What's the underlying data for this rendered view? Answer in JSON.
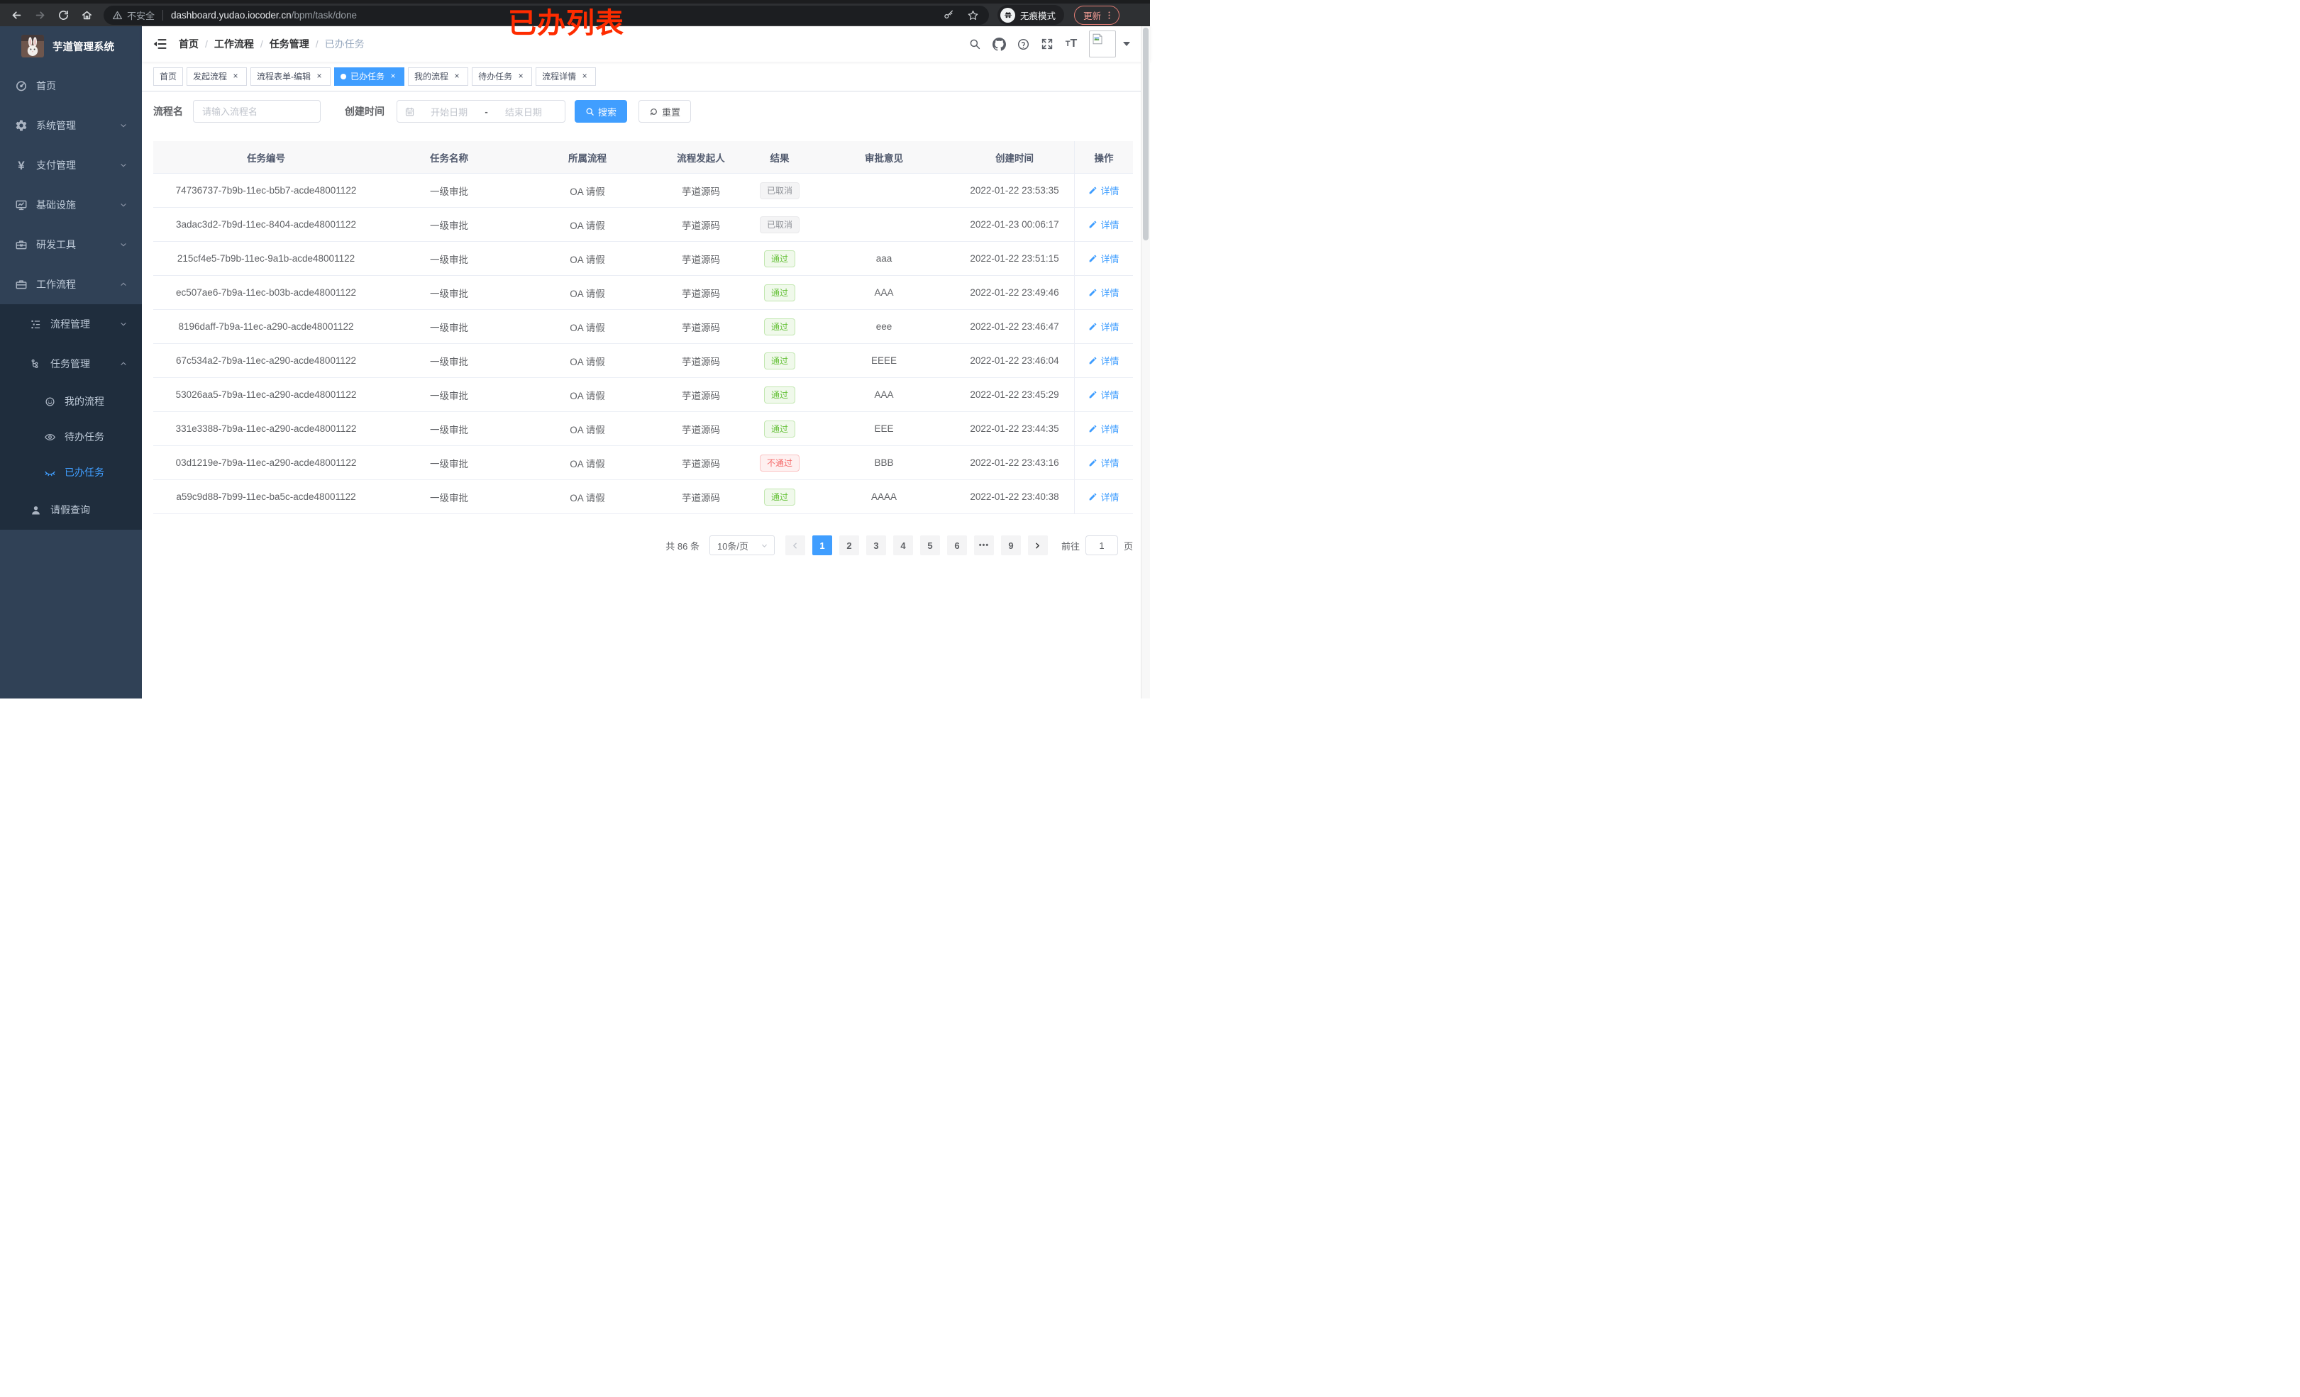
{
  "browser": {
    "security_label": "不安全",
    "url_host": "dashboard.yudao.iocoder.cn",
    "url_path": "/bpm/task/done",
    "incognito_label": "无痕模式",
    "update_label": "更新"
  },
  "annotation": {
    "text": "已办列表",
    "color": "#fe2c00"
  },
  "sidebar": {
    "title": "芋道管理系统",
    "items": [
      {
        "label": "首页"
      },
      {
        "label": "系统管理"
      },
      {
        "label": "支付管理"
      },
      {
        "label": "基础设施"
      },
      {
        "label": "研发工具"
      },
      {
        "label": "工作流程"
      },
      {
        "label": "流程管理"
      },
      {
        "label": "任务管理"
      },
      {
        "label": "我的流程"
      },
      {
        "label": "待办任务"
      },
      {
        "label": "已办任务"
      },
      {
        "label": "请假查询"
      }
    ]
  },
  "breadcrumb": [
    "首页",
    "工作流程",
    "任务管理",
    "已办任务"
  ],
  "tabs": [
    {
      "label": "首页",
      "closable": false,
      "active": false
    },
    {
      "label": "发起流程",
      "closable": true,
      "active": false
    },
    {
      "label": "流程表单-编辑",
      "closable": true,
      "active": false
    },
    {
      "label": "已办任务",
      "closable": true,
      "active": true
    },
    {
      "label": "我的流程",
      "closable": true,
      "active": false
    },
    {
      "label": "待办任务",
      "closable": true,
      "active": false
    },
    {
      "label": "流程详情",
      "closable": true,
      "active": false
    }
  ],
  "filters": {
    "name_label": "流程名",
    "name_placeholder": "请输入流程名",
    "time_label": "创建时间",
    "start_placeholder": "开始日期",
    "range_separator": "-",
    "end_placeholder": "结束日期",
    "search_label": "搜索",
    "reset_label": "重置"
  },
  "table": {
    "columns": [
      "任务编号",
      "任务名称",
      "所属流程",
      "流程发起人",
      "结果",
      "审批意见",
      "创建时间",
      "操作"
    ],
    "action_label": "详情",
    "rows": [
      {
        "id": "74736737-7b9b-11ec-b5b7-acde48001122",
        "name": "一级审批",
        "process": "OA 请假",
        "starter": "芋道源码",
        "result": "已取消",
        "result_type": "info",
        "comment": "",
        "time": "2022-01-22 23:53:35"
      },
      {
        "id": "3adac3d2-7b9d-11ec-8404-acde48001122",
        "name": "一级审批",
        "process": "OA 请假",
        "starter": "芋道源码",
        "result": "已取消",
        "result_type": "info",
        "comment": "",
        "time": "2022-01-23 00:06:17"
      },
      {
        "id": "215cf4e5-7b9b-11ec-9a1b-acde48001122",
        "name": "一级审批",
        "process": "OA 请假",
        "starter": "芋道源码",
        "result": "通过",
        "result_type": "success",
        "comment": "aaa",
        "time": "2022-01-22 23:51:15"
      },
      {
        "id": "ec507ae6-7b9a-11ec-b03b-acde48001122",
        "name": "一级审批",
        "process": "OA 请假",
        "starter": "芋道源码",
        "result": "通过",
        "result_type": "success",
        "comment": "AAA",
        "time": "2022-01-22 23:49:46"
      },
      {
        "id": "8196daff-7b9a-11ec-a290-acde48001122",
        "name": "一级审批",
        "process": "OA 请假",
        "starter": "芋道源码",
        "result": "通过",
        "result_type": "success",
        "comment": "eee",
        "time": "2022-01-22 23:46:47"
      },
      {
        "id": "67c534a2-7b9a-11ec-a290-acde48001122",
        "name": "一级审批",
        "process": "OA 请假",
        "starter": "芋道源码",
        "result": "通过",
        "result_type": "success",
        "comment": "EEEE",
        "time": "2022-01-22 23:46:04"
      },
      {
        "id": "53026aa5-7b9a-11ec-a290-acde48001122",
        "name": "一级审批",
        "process": "OA 请假",
        "starter": "芋道源码",
        "result": "通过",
        "result_type": "success",
        "comment": "AAA",
        "time": "2022-01-22 23:45:29"
      },
      {
        "id": "331e3388-7b9a-11ec-a290-acde48001122",
        "name": "一级审批",
        "process": "OA 请假",
        "starter": "芋道源码",
        "result": "通过",
        "result_type": "success",
        "comment": "EEE",
        "time": "2022-01-22 23:44:35"
      },
      {
        "id": "03d1219e-7b9a-11ec-a290-acde48001122",
        "name": "一级审批",
        "process": "OA 请假",
        "starter": "芋道源码",
        "result": "不通过",
        "result_type": "danger",
        "comment": "BBB",
        "time": "2022-01-22 23:43:16"
      },
      {
        "id": "a59c9d88-7b99-11ec-ba5c-acde48001122",
        "name": "一级审批",
        "process": "OA 请假",
        "starter": "芋道源码",
        "result": "通过",
        "result_type": "success",
        "comment": "AAAA",
        "time": "2022-01-22 23:40:38"
      }
    ]
  },
  "pagination": {
    "total_label": "共 86 条",
    "page_size": "10条/页",
    "pages": [
      "1",
      "2",
      "3",
      "4",
      "5",
      "6",
      "•••",
      "9"
    ],
    "active_page": "1",
    "goto_label": "前往",
    "goto_value": "1",
    "page_unit": "页"
  },
  "colors": {
    "accent": "#409eff",
    "success": "#67c23a",
    "danger": "#f56c6c",
    "info": "#909399",
    "sidebar_bg": "#304156",
    "submenu_bg": "#1f2d3d",
    "annotation_red": "#fe2c00"
  }
}
